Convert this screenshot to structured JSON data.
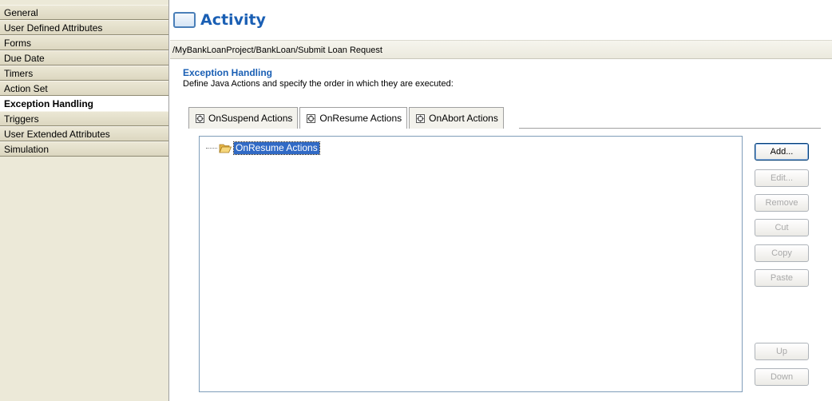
{
  "sidebar": {
    "items": [
      {
        "label": "General"
      },
      {
        "label": "User Defined Attributes"
      },
      {
        "label": "Forms"
      },
      {
        "label": "Due Date"
      },
      {
        "label": "Timers"
      },
      {
        "label": "Action Set"
      },
      {
        "label": "Exception Handling",
        "selected": true
      },
      {
        "label": "Triggers"
      },
      {
        "label": "User Extended Attributes"
      },
      {
        "label": "Simulation"
      }
    ]
  },
  "header": {
    "title": "Activity",
    "breadcrumb": "/MyBankLoanProject/BankLoan/Submit Loan Request"
  },
  "section": {
    "title": "Exception Handling",
    "description": "Define Java Actions and specify the order in which they are executed:"
  },
  "tabs": [
    {
      "label": "OnSuspend Actions",
      "icon": "action-set-icon",
      "active": false
    },
    {
      "label": "OnResume Actions",
      "icon": "action-set-icon",
      "active": true
    },
    {
      "label": "OnAbort Actions",
      "icon": "action-set-icon",
      "active": false
    }
  ],
  "tree": {
    "root_label": "OnResume Actions",
    "root_icon": "open-folder-icon"
  },
  "buttons": {
    "add": "Add...",
    "edit": "Edit...",
    "remove": "Remove",
    "cut": "Cut",
    "copy": "Copy",
    "paste": "Paste",
    "up": "Up",
    "down": "Down"
  },
  "colors": {
    "accent": "#1a5fb4",
    "selection": "#316ac5",
    "sidebar_bg": "#ece9d8"
  }
}
